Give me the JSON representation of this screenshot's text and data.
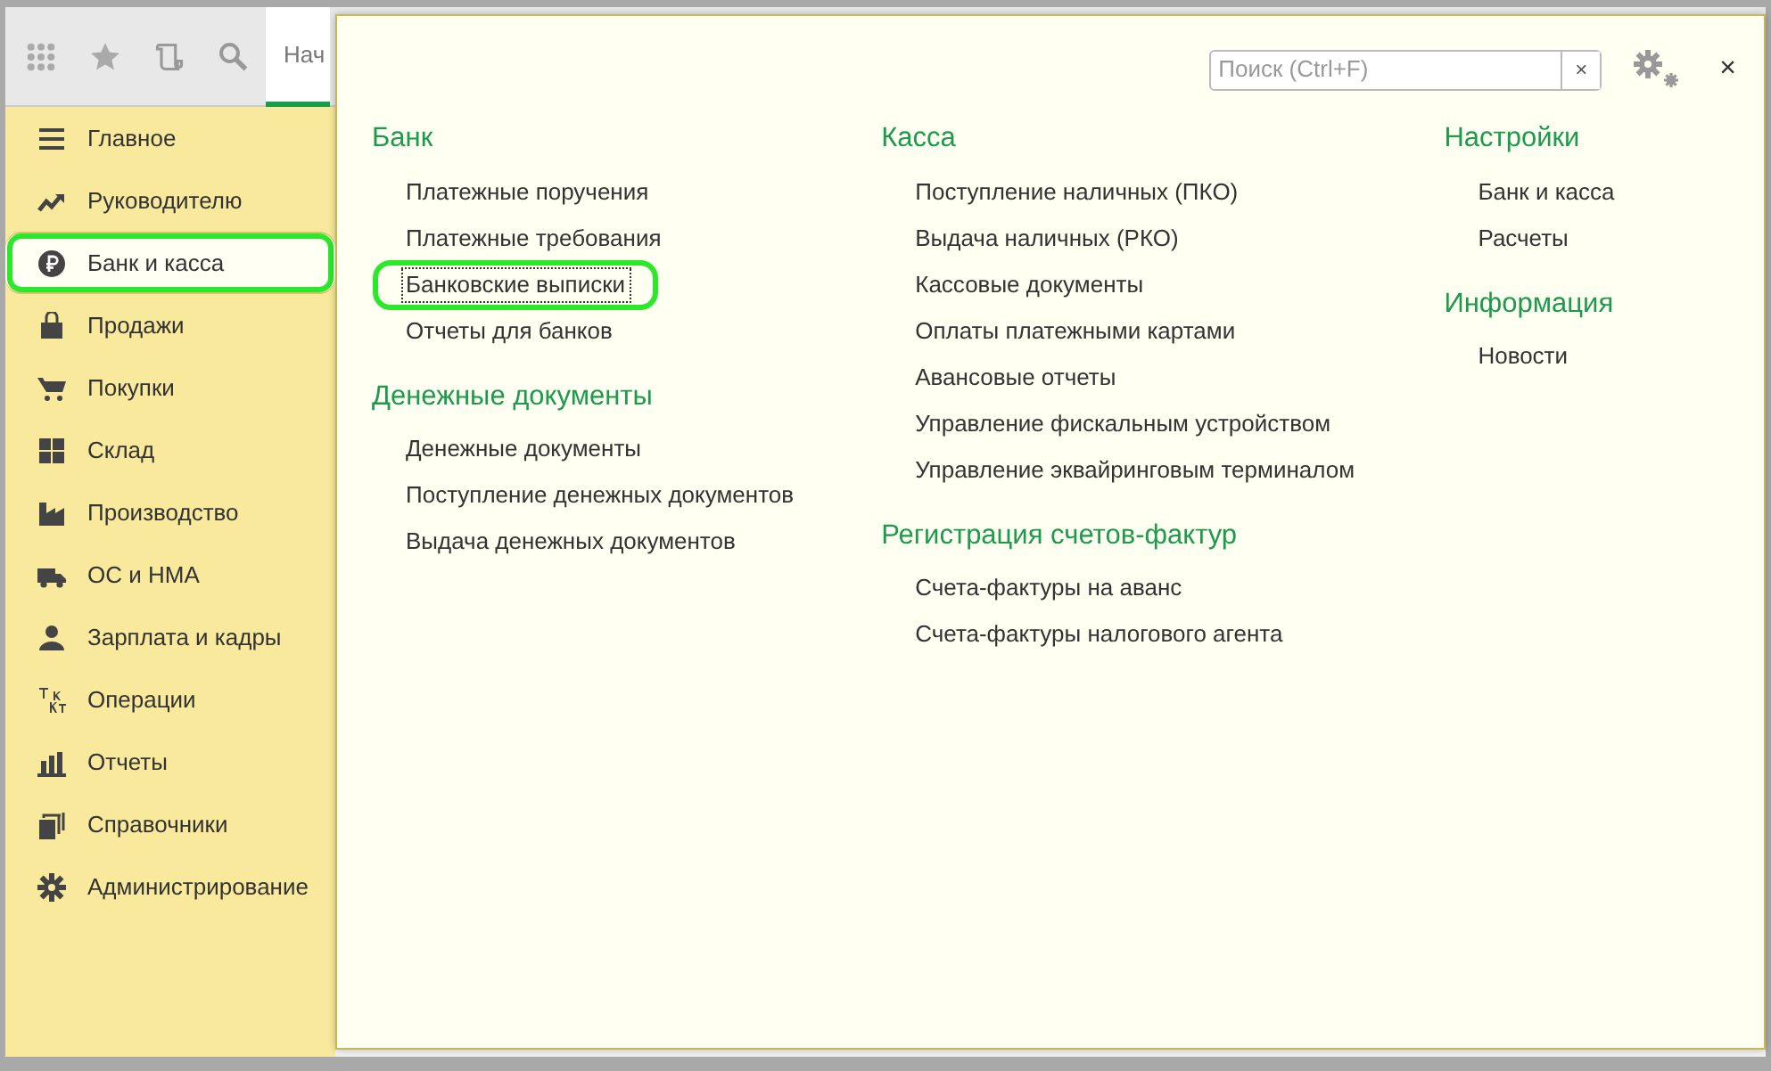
{
  "toolbar": {
    "tab": {
      "label": "Нач",
      "selected": true
    }
  },
  "sidebar": {
    "items": [
      {
        "label": "Главное",
        "selected": false,
        "circled": false
      },
      {
        "label": "Руководителю",
        "selected": false,
        "circled": false
      },
      {
        "label": "Банк и касса",
        "selected": true,
        "circled": true
      },
      {
        "label": "Продажи",
        "selected": false,
        "circled": false
      },
      {
        "label": "Покупки",
        "selected": false,
        "circled": false
      },
      {
        "label": "Склад",
        "selected": false,
        "circled": false
      },
      {
        "label": "Производство",
        "selected": false,
        "circled": false
      },
      {
        "label": "ОС и НМА",
        "selected": false,
        "circled": false
      },
      {
        "label": "Зарплата и кадры",
        "selected": false,
        "circled": false
      },
      {
        "label": "Операции",
        "selected": false,
        "circled": false
      },
      {
        "label": "Отчеты",
        "selected": false,
        "circled": false
      },
      {
        "label": "Справочники",
        "selected": false,
        "circled": false
      },
      {
        "label": "Администрирование",
        "selected": false,
        "circled": false
      }
    ]
  },
  "panel": {
    "search": {
      "placeholder": "Поиск (Ctrl+F)",
      "clear": "×"
    },
    "close": "×",
    "columns": [
      [
        {
          "title": "Банк",
          "links": [
            {
              "label": "Платежные поручения",
              "focused": false,
              "circled": false
            },
            {
              "label": "Платежные требования",
              "focused": false,
              "circled": false
            },
            {
              "label": "Банковские выписки",
              "focused": true,
              "circled": true
            },
            {
              "label": "Отчеты для банков",
              "focused": false,
              "circled": false
            }
          ]
        },
        {
          "title": "Денежные документы",
          "links": [
            {
              "label": "Денежные документы",
              "focused": false,
              "circled": false
            },
            {
              "label": "Поступление денежных документов",
              "focused": false,
              "circled": false
            },
            {
              "label": "Выдача денежных документов",
              "focused": false,
              "circled": false
            }
          ]
        }
      ],
      [
        {
          "title": "Касса",
          "links": [
            {
              "label": "Поступление наличных (ПКО)",
              "focused": false,
              "circled": false
            },
            {
              "label": "Выдача наличных (РКО)",
              "focused": false,
              "circled": false
            },
            {
              "label": "Кассовые документы",
              "focused": false,
              "circled": false
            },
            {
              "label": "Оплаты платежными картами",
              "focused": false,
              "circled": false
            },
            {
              "label": "Авансовые отчеты",
              "focused": false,
              "circled": false
            },
            {
              "label": "Управление фискальным устройством",
              "focused": false,
              "circled": false
            },
            {
              "label": "Управление эквайринговым терминалом",
              "focused": false,
              "circled": false
            }
          ]
        },
        {
          "title": "Регистрация счетов-фактур",
          "links": [
            {
              "label": "Счета-фактуры на аванс",
              "focused": false,
              "circled": false
            },
            {
              "label": "Счета-фактуры налогового агента",
              "focused": false,
              "circled": false
            }
          ]
        }
      ],
      [
        {
          "title": "Настройки",
          "links": [
            {
              "label": "Банк и касса",
              "focused": false,
              "circled": false
            },
            {
              "label": "Расчеты",
              "focused": false,
              "circled": false
            }
          ]
        },
        {
          "title": "Информация",
          "links": [
            {
              "label": "Новости",
              "focused": false,
              "circled": false
            }
          ]
        }
      ]
    ]
  }
}
